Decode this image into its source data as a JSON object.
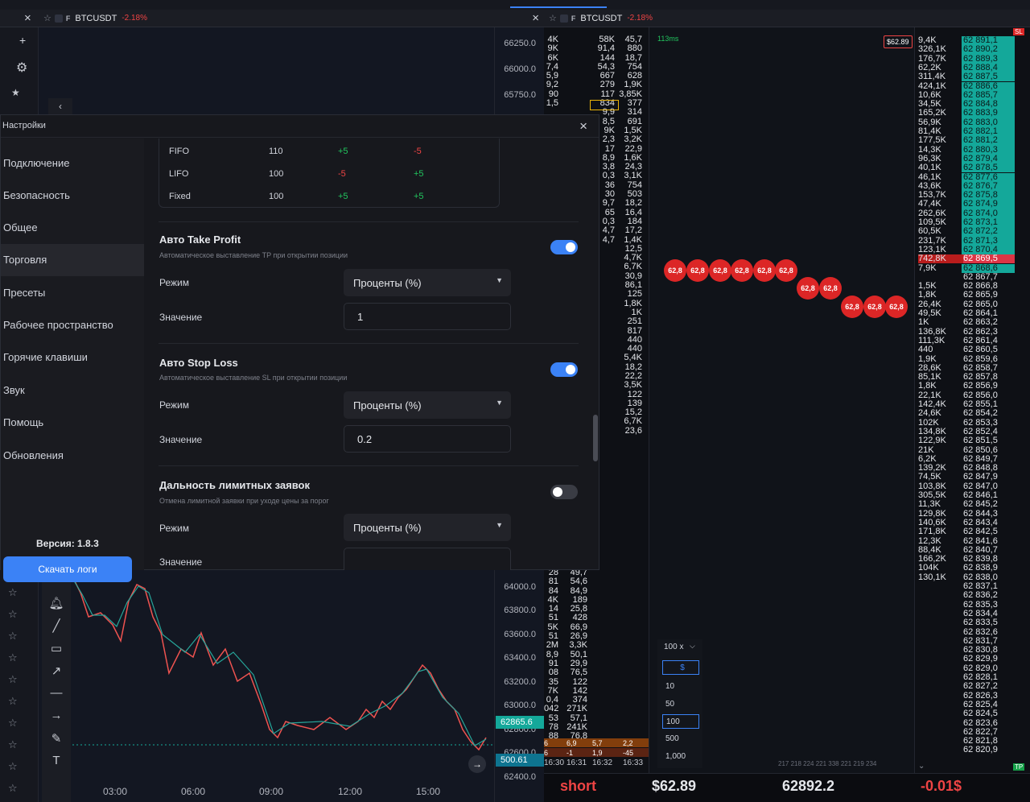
{
  "left_tab": {
    "symbol": "BTCUSDT",
    "change": "-2.18%"
  },
  "right_tab": {
    "symbol": "BTCUSDT",
    "change": "-2.18%"
  },
  "left_chart": {
    "price_ticks_top": [
      "66250.0",
      "66000.0",
      "65750.0"
    ],
    "price_ticks_bottom": [
      "64000.0",
      "63800.0",
      "63600.0",
      "63400.0",
      "63200.0",
      "63000.0",
      "62800.0",
      "62600.0",
      "62400.0"
    ],
    "last_price_tag": "62865.6",
    "volume_tag": "500.61",
    "time_ticks": [
      "03:00",
      "06:00",
      "09:00",
      "12:00",
      "15:00"
    ],
    "interval": "5m"
  },
  "settings": {
    "title": "Настройки",
    "nav": [
      "Подключение",
      "Безопасность",
      "Общее",
      "Торговля",
      "Пресеты",
      "Рабочее пространство",
      "Горячие клавиши",
      "Звук",
      "Помощь",
      "Обновления"
    ],
    "active_nav": "Торговля",
    "version": "Версия: 1.8.3",
    "download_logs": "Скачать логи",
    "table_rows": [
      {
        "name": "FIFO",
        "value": "110",
        "a": "+5",
        "b": "-5"
      },
      {
        "name": "LIFO",
        "value": "100",
        "a": "-5",
        "b": "+5"
      },
      {
        "name": "Fixed",
        "value": "100",
        "a": "+5",
        "b": "+5"
      }
    ],
    "take_profit": {
      "title": "Авто Take Profit",
      "desc": "Автоматическое выставление TP при открытии позиции",
      "mode_label": "Режим",
      "mode_value": "Проценты (%)",
      "value_label": "Значение",
      "value": "1",
      "enabled": true
    },
    "stop_loss": {
      "title": "Авто Stop Loss",
      "desc": "Автоматическое выставление SL при открытии позиции",
      "mode_label": "Режим",
      "mode_value": "Проценты (%)",
      "value_label": "Значение",
      "value": "0.2",
      "enabled": true
    },
    "limit_range": {
      "title": "Дальность лимитных заявок",
      "desc": "Отмена лимитной заявки при уходе цены за порог",
      "mode_label": "Режим",
      "mode_value": "Проценты (%)",
      "value_label": "Значение",
      "value": "",
      "enabled": false
    }
  },
  "mid_book": {
    "col1": [
      "4K",
      "9K",
      "6K",
      "7,4",
      "5,9",
      "9,2",
      "90",
      "1,5"
    ],
    "col2": [
      "58K",
      "91,4",
      "144",
      "54,3",
      "667",
      "279",
      "117",
      "834",
      "9,9",
      "8,5",
      "9K",
      "2,3",
      "17",
      "8,9",
      "3,8",
      "0,3",
      "36",
      "30",
      "9,7",
      "65",
      "0,3",
      "4,7",
      "4,7"
    ],
    "col3": [
      "45,7",
      "880",
      "18,7",
      "754",
      "628",
      "1,9K",
      "3,85K",
      "377",
      "314",
      "691",
      "1,5K",
      "3,2K",
      "22,9",
      "1,6K",
      "24,3",
      "3,1K",
      "754",
      "503",
      "18,2",
      "16,4",
      "184",
      "17,2",
      "1,4K",
      "12,5",
      "4,7K",
      "6,7K",
      "30,9",
      "86,1",
      "125",
      "1,8K",
      "1K",
      "251",
      "817",
      "440",
      "440",
      "5,4K",
      "18,2",
      "22,2",
      "3,5K",
      "122",
      "139",
      "15,2",
      "6,7K",
      "23,6"
    ],
    "lower_col1": [
      "28",
      "81",
      "84",
      "4K",
      "14",
      "51",
      "5K",
      "51",
      "2M",
      "8,9",
      "91",
      "08",
      "35",
      "7K",
      "0,4",
      "042",
      "53",
      "78",
      "88"
    ],
    "lower_col2": [
      "49,7",
      "54,6",
      "84,9",
      "189",
      "25,8",
      "428",
      "66,9",
      "26,9",
      "3,3K",
      "50,1",
      "29,9",
      "76,5",
      "122",
      "142",
      "374",
      "271K",
      "57,1",
      "241K",
      "76,8"
    ],
    "row_a": [
      "6",
      "6,9",
      "5,7",
      "2,2"
    ],
    "row_b": [
      "6",
      "-1",
      "1,9",
      "-45"
    ],
    "times": [
      "16:30",
      "16:31",
      "16:32",
      "16:33"
    ]
  },
  "right_panel": {
    "latency": "113ms",
    "price_tag": "$62.89",
    "bubble_label": "62,8",
    "qty_header": "100 x",
    "qty_currency": "$",
    "qty_options": [
      "10",
      "50",
      "100",
      "500",
      "1,000"
    ],
    "qty_selected": "100",
    "bottom_numbers": "217 218 224 221 338 221 219 234"
  },
  "book": {
    "sl_tag": "SL",
    "tp_tag": "TP",
    "vols": [
      "9,4K",
      "326,1K",
      "176,7K",
      "62,2K",
      "311,4K",
      "424,1K",
      "10,6K",
      "34,5K",
      "165,2K",
      "56,9K",
      "81,4K",
      "177,5K",
      "14,3K",
      "96,3K",
      "40,1K",
      "46,1K",
      "43,6K",
      "153,7K",
      "47,4K",
      "262,6K",
      "109,5K",
      "60,5K",
      "231,7K",
      "123,1K",
      "742,8K",
      "7,9K",
      "",
      "1,5K",
      "1,8K",
      "26,4K",
      "49,5K",
      "1K",
      "136,8K",
      "111,3K",
      "440",
      "1,9K",
      "28,6K",
      "85,1K",
      "1,8K",
      "22,1K",
      "142,4K",
      "24,6K",
      "102K",
      "134,8K",
      "122,9K",
      "21K",
      "6,2K",
      "139,2K",
      "74,5K",
      "103,8K",
      "305,5K",
      "11,3K",
      "129,8K",
      "140,6K",
      "171,8K",
      "12,3K",
      "88,4K",
      "166,2K",
      "104K",
      "130,1K"
    ],
    "prices": [
      "62 891,1",
      "62 890,2",
      "62 889,3",
      "62 888,4",
      "62 887,5",
      "62 886,6",
      "62 885,7",
      "62 884,8",
      "62 883,9",
      "62 883,0",
      "62 882,1",
      "62 881,2",
      "62 880,3",
      "62 879,4",
      "62 878,5",
      "62 877,6",
      "62 876,7",
      "62 875,8",
      "62 874,9",
      "62 874,0",
      "62 873,1",
      "62 872,2",
      "62 871,3",
      "62 870,4",
      "62 869,5",
      "62 868,6",
      "62 867,7",
      "62 866,8",
      "62 865,9",
      "62 865,0",
      "62 864,1",
      "62 863,2",
      "62 862,3",
      "62 861,4",
      "62 860,5",
      "62 859,6",
      "62 858,7",
      "62 857,8",
      "62 856,9",
      "62 856,0",
      "62 855,1",
      "62 854,2",
      "62 853,3",
      "62 852,4",
      "62 851,5",
      "62 850,6",
      "62 849,7",
      "62 848,8",
      "62 847,9",
      "62 847,0",
      "62 846,1",
      "62 845,2",
      "62 844,3",
      "62 843,4",
      "62 842,5",
      "62 841,6",
      "62 840,7",
      "62 839,8",
      "62 838,9",
      "62 838,0",
      "62 837,1",
      "62 836,2",
      "62 835,3",
      "62 834,4",
      "62 833,5",
      "62 832,6",
      "62 831,7",
      "62 830,8",
      "62 829,9",
      "62 829,0",
      "62 828,1",
      "62 827,2",
      "62 826,3",
      "62 825,4",
      "62 824,5",
      "62 823,6",
      "62 822,7",
      "62 821,8",
      "62 820,9"
    ]
  },
  "footer": {
    "side": "short",
    "pnl_usd": "$62.89",
    "price": "62892.2",
    "change": "-0.01$"
  },
  "colors": {
    "accent": "#3b82f6",
    "ask": "#14a89a",
    "bid_mark": "#dc3545",
    "negative": "#ef4444",
    "positive": "#22c55e"
  }
}
